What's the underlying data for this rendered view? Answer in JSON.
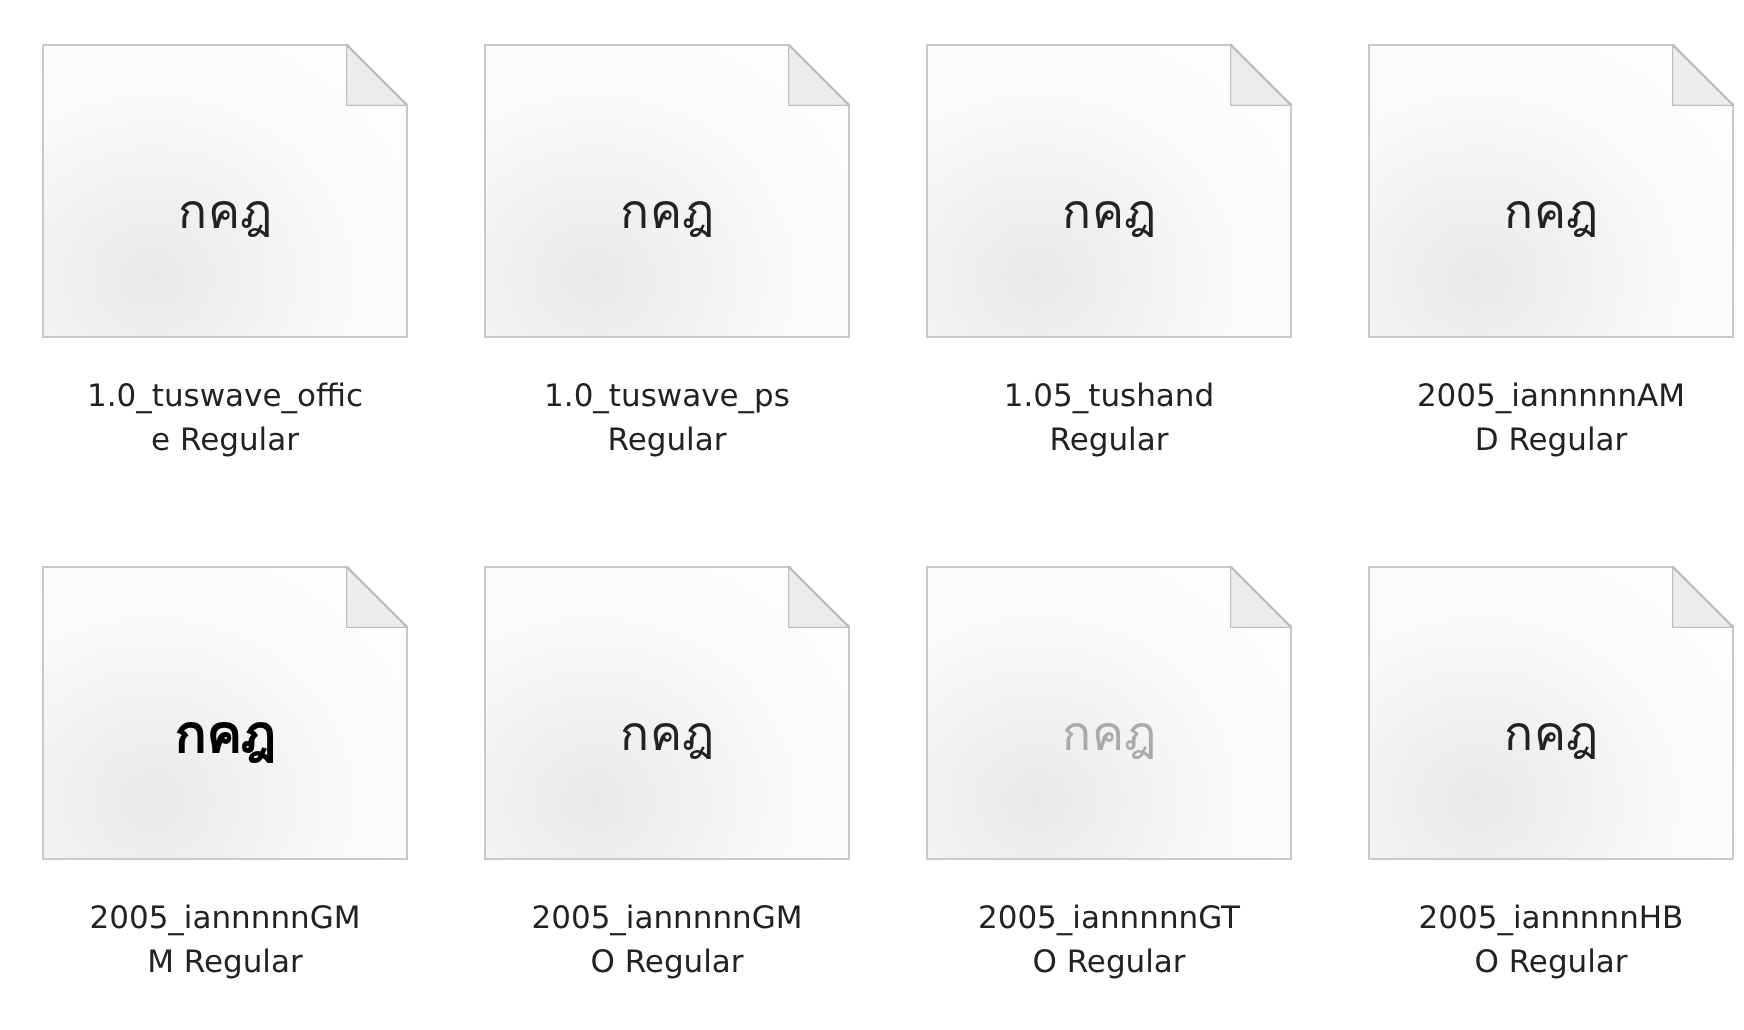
{
  "files": [
    {
      "preview": "กคฎ",
      "kind": "plain",
      "label_lines": [
        "1.0_tuswave_offic",
        "e Regular"
      ]
    },
    {
      "preview": "กคฎ",
      "kind": "plain",
      "label_lines": [
        "1.0_tuswave_ps",
        "Regular"
      ]
    },
    {
      "preview": "กคฎ",
      "kind": "plain",
      "label_lines": [
        "1.05_tushand",
        "Regular"
      ]
    },
    {
      "preview": "กคฎ",
      "kind": "plain",
      "label_lines": [
        "2005_iannnnnAM",
        "D Regular"
      ]
    },
    {
      "preview": "กคฎ",
      "kind": "bold",
      "label_lines": [
        "2005_iannnnnGM",
        "M Regular"
      ]
    },
    {
      "preview": "กคฎ",
      "kind": "plain",
      "label_lines": [
        "2005_iannnnnGM",
        "O Regular"
      ]
    },
    {
      "preview": "กคฎ",
      "kind": "faded",
      "label_lines": [
        "2005_iannnnnGT",
        "O Regular"
      ]
    },
    {
      "preview": "กคฎ",
      "kind": "plain",
      "label_lines": [
        "2005_iannnnnHB",
        "O Regular"
      ]
    }
  ]
}
